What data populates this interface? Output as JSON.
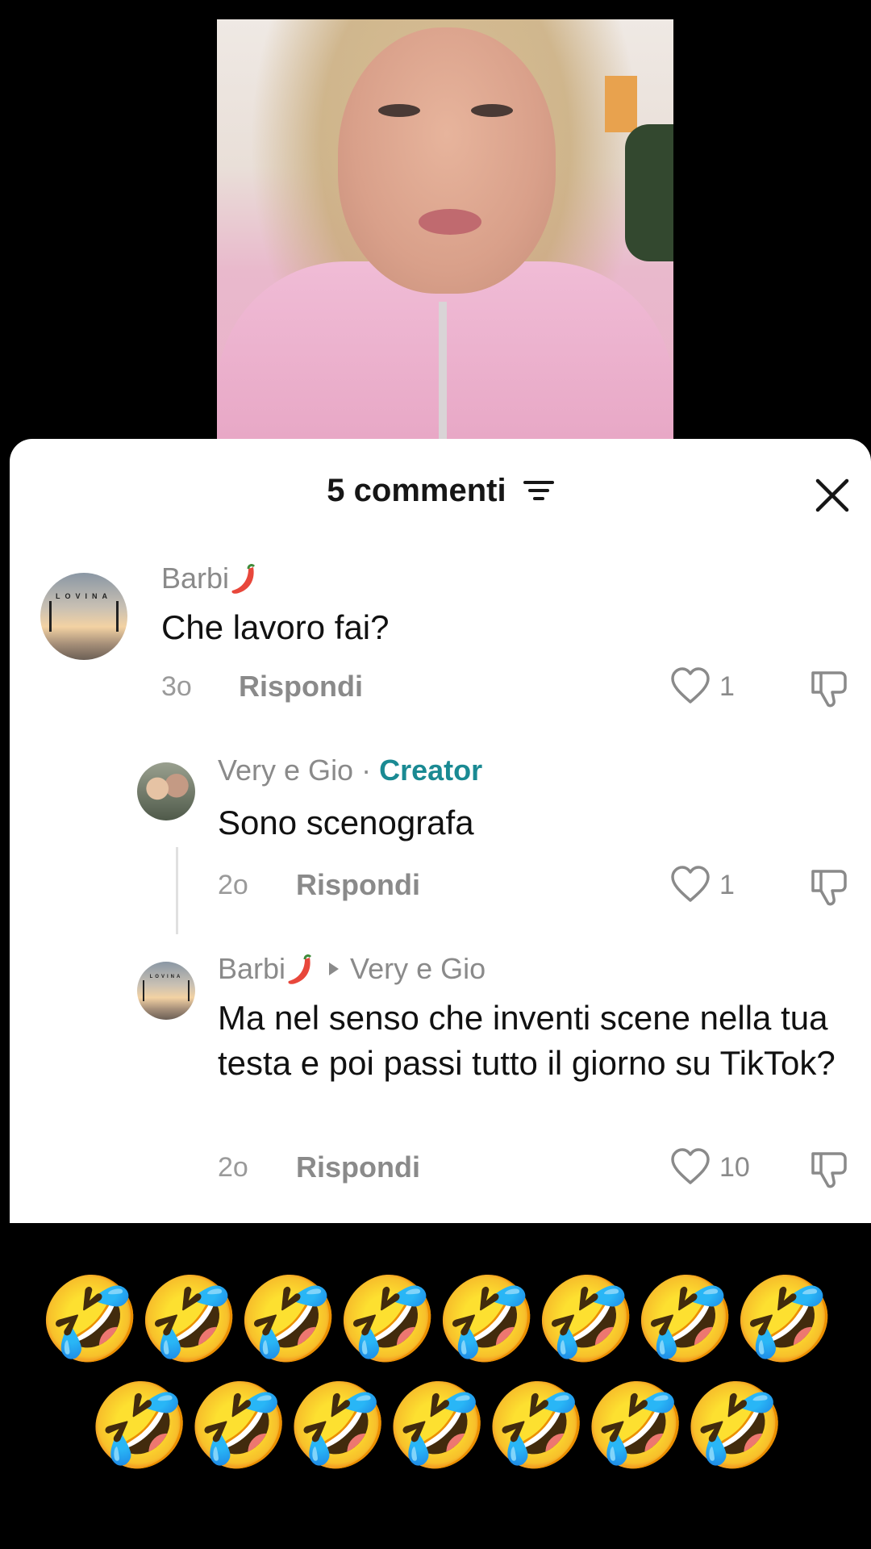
{
  "comments_panel": {
    "title": "5 commenti",
    "filter_icon": "filter-icon",
    "close_icon": "close-icon"
  },
  "comments": [
    {
      "username": "Barbi",
      "username_emoji": "chili-pepper-icon",
      "text": "Che lavoro fai?",
      "time": "3o",
      "reply_label": "Rispondi",
      "likes": "1"
    },
    {
      "username": "Very e Gio",
      "separator": "·",
      "badge": "Creator",
      "text": "Sono scenografa",
      "time": "2o",
      "reply_label": "Rispondi",
      "likes": "1"
    },
    {
      "username": "Barbi",
      "username_emoji": "chili-pepper-icon",
      "reply_to": "Very e Gio",
      "text": "Ma nel senso che inventi scene nella tua testa e poi passi tutto il giorno su TikTok?",
      "time": "2o",
      "reply_label": "Rispondi",
      "likes": "10"
    }
  ],
  "avatar_text": "LOVINA",
  "emoji_rows": [
    "🤣🤣🤣🤣🤣🤣🤣🤣",
    "🤣🤣🤣🤣🤣🤣🤣"
  ],
  "colors": {
    "creator_badge": "#1a8a93",
    "sheet_bg": "#ffffff",
    "page_bg": "#000000"
  }
}
